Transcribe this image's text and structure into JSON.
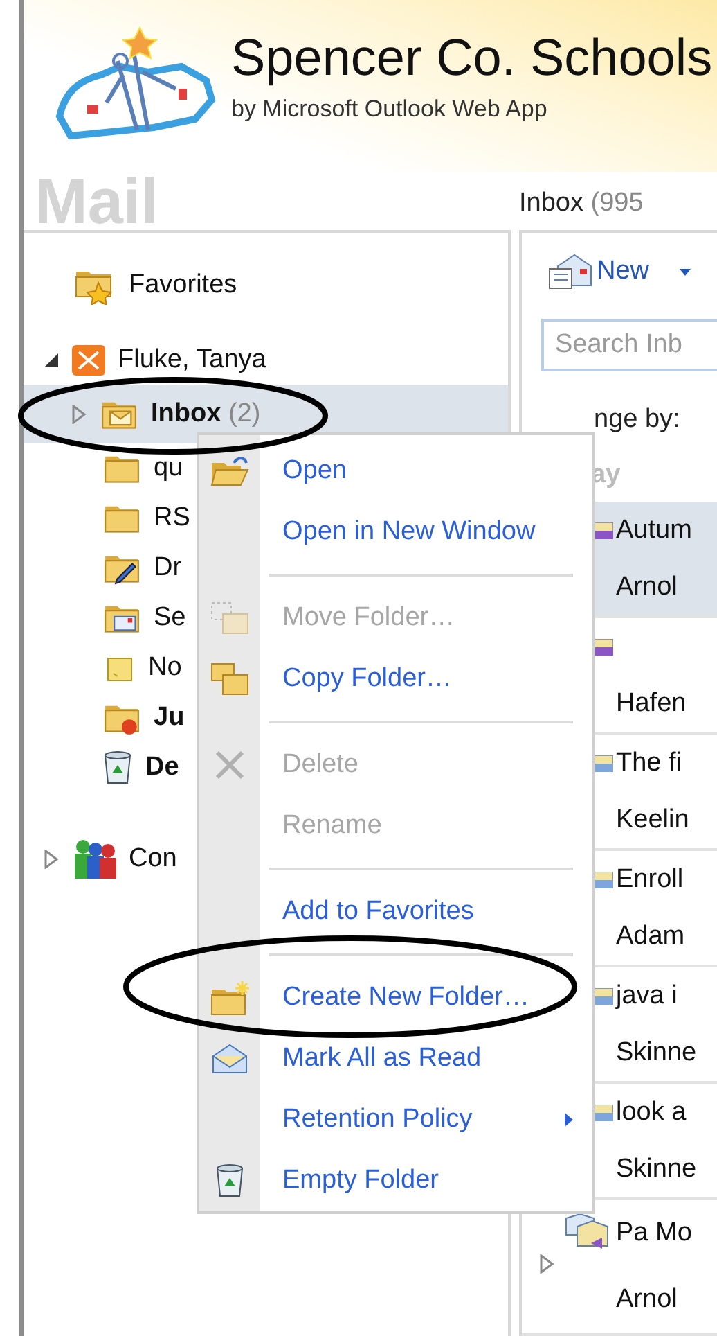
{
  "header": {
    "title": "Spencer Co. Schools",
    "subtitle": "by Microsoft Outlook Web App"
  },
  "module_title": "Mail",
  "folder_heading": {
    "name": "Inbox",
    "count": "(995"
  },
  "navigation": {
    "favorites": "Favorites",
    "mailbox": {
      "name": "Fluke, Tanya",
      "expanded": true
    },
    "folders": [
      {
        "name": "Inbox",
        "count": "(2)",
        "kind": "inbox",
        "selected": true,
        "unread": true,
        "has_subfolders": true
      },
      {
        "name": "qu",
        "kind": "folder",
        "selected": false,
        "unread": false,
        "has_subfolders": false
      },
      {
        "name": "RS",
        "kind": "folder",
        "selected": false,
        "unread": false,
        "has_subfolders": false
      },
      {
        "name": "Dr",
        "kind": "drafts",
        "selected": false,
        "unread": false,
        "has_subfolders": false
      },
      {
        "name": "Se",
        "kind": "sent",
        "selected": false,
        "unread": false,
        "has_subfolders": false
      },
      {
        "name": "No",
        "kind": "notes",
        "selected": false,
        "unread": false,
        "has_subfolders": false
      },
      {
        "name": "Ju",
        "kind": "junk",
        "selected": false,
        "unread": true,
        "has_subfolders": false
      },
      {
        "name": "De",
        "kind": "deleted",
        "selected": false,
        "unread": true,
        "has_subfolders": false
      }
    ],
    "contacts": {
      "name": "Con",
      "expanded": false
    }
  },
  "context_menu": [
    {
      "kind": "open",
      "label": "Open",
      "disabled": false,
      "submenu": false
    },
    {
      "kind": "plain",
      "label": "Open in New Window",
      "disabled": false,
      "submenu": false
    },
    {
      "kind": "separator"
    },
    {
      "kind": "move",
      "label": "Move Folder…",
      "disabled": true,
      "submenu": false
    },
    {
      "kind": "copy",
      "label": "Copy Folder…",
      "disabled": false,
      "submenu": false
    },
    {
      "kind": "separator"
    },
    {
      "kind": "delete",
      "label": "Delete",
      "disabled": true,
      "submenu": false
    },
    {
      "kind": "plain",
      "label": "Rename",
      "disabled": true,
      "submenu": false
    },
    {
      "kind": "separator"
    },
    {
      "kind": "plain",
      "label": "Add to Favorites",
      "disabled": false,
      "submenu": false
    },
    {
      "kind": "separator"
    },
    {
      "kind": "new_folder",
      "label": "Create New Folder…",
      "disabled": false,
      "submenu": false
    },
    {
      "kind": "mark_read",
      "label": "Mark All as Read",
      "disabled": false,
      "submenu": false
    },
    {
      "kind": "plain",
      "label": "Retention Policy",
      "disabled": false,
      "submenu": true
    },
    {
      "kind": "empty",
      "label": "Empty Folder",
      "disabled": false,
      "submenu": false
    }
  ],
  "message_pane": {
    "new_button": "New",
    "search": {
      "placeholder": "Search Inb"
    },
    "arrange_by": "nge by:",
    "group_heading": "ay",
    "messages": [
      {
        "kind": "meeting",
        "subject": "Autum",
        "sender": "Arnol",
        "selected": true
      },
      {
        "kind": "meeting",
        "sender": "Hafen",
        "selected": false
      },
      {
        "kind": "message",
        "subject": "The fi",
        "sender": "Keelin",
        "selected": false
      },
      {
        "kind": "message",
        "subject": "Enroll",
        "sender": "Adam",
        "selected": false
      },
      {
        "kind": "message",
        "subject": "java i",
        "sender": "Skinne",
        "selected": false
      },
      {
        "kind": "message",
        "subject": "look a",
        "sender": "Skinne",
        "selected": false
      },
      {
        "kind": "conversation",
        "subject": "Pa Mo",
        "sender": "Arnol",
        "selected": false
      }
    ]
  },
  "annotations": [
    {
      "kind": "ellipse"
    },
    {
      "kind": "ellipse"
    }
  ]
}
